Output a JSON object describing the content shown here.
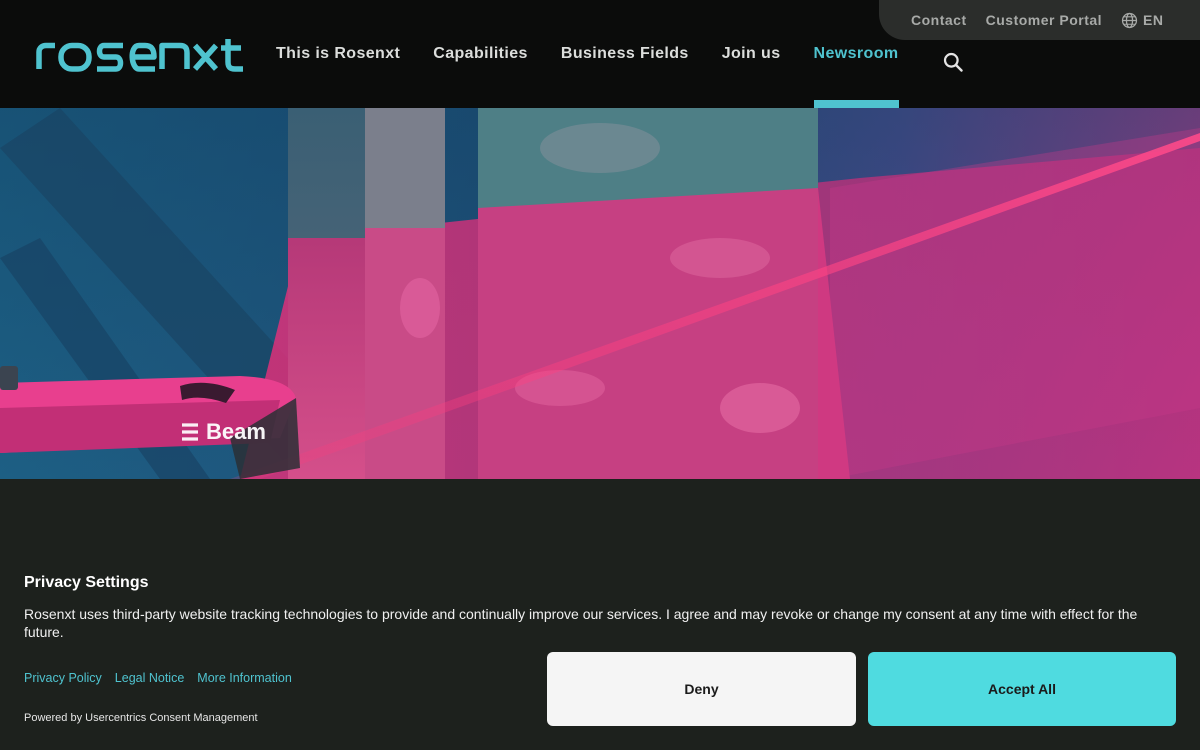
{
  "header": {
    "logo_text": "rosenxt",
    "utility": {
      "contact": "Contact",
      "customer_portal": "Customer Portal",
      "language": "EN"
    },
    "nav": [
      {
        "label": "This is Rosenxt",
        "active": false
      },
      {
        "label": "Capabilities",
        "active": false
      },
      {
        "label": "Business Fields",
        "active": false
      },
      {
        "label": "Join us",
        "active": false
      },
      {
        "label": "Newsroom",
        "active": true
      }
    ]
  },
  "hero": {
    "vehicle_brand": "Beam"
  },
  "consent": {
    "title": "Privacy Settings",
    "text": "Rosenxt uses third-party website tracking technologies to provide and continually improve our services. I agree and may revoke or change my consent at any time with effect for the future.",
    "links": {
      "privacy_policy": "Privacy Policy",
      "legal_notice": "Legal Notice",
      "more_info": "More Information"
    },
    "powered_by": "Powered by Usercentrics Consent Management",
    "deny_label": "Deny",
    "accept_label": "Accept All"
  },
  "colors": {
    "accent": "#4fc3cf",
    "accept_button": "#4fdbe0",
    "header_bg": "#0b0c0b",
    "consent_bg": "#1d211d",
    "hero_magenta": "#e0307a"
  }
}
